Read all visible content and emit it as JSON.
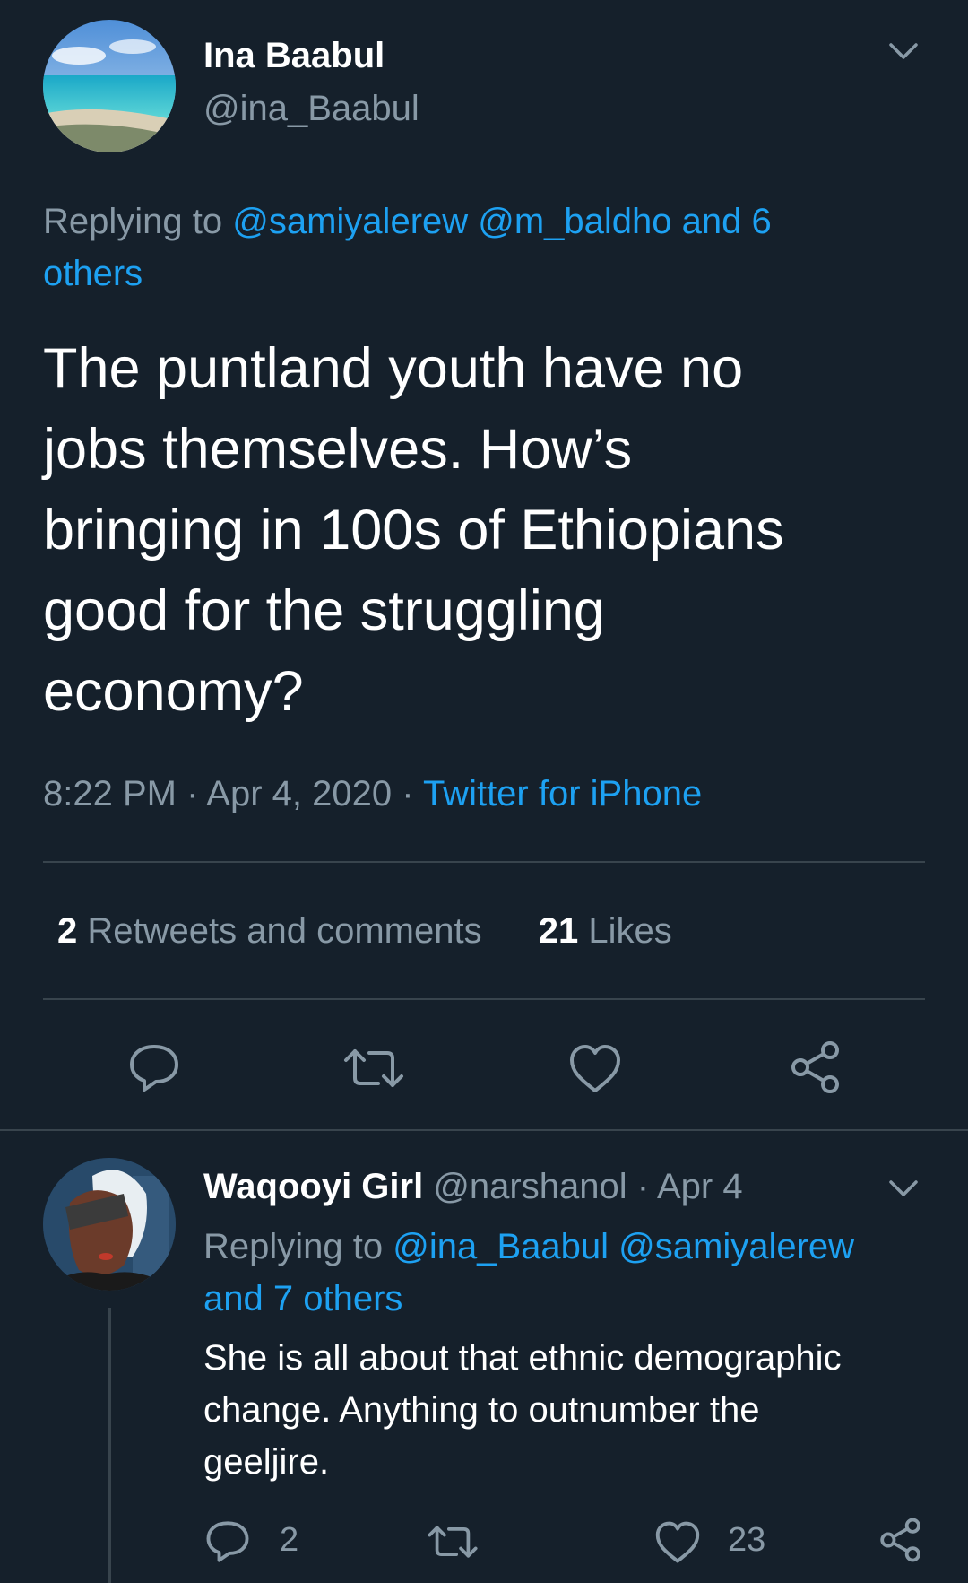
{
  "tweet": {
    "author_name": "Ina Baabul",
    "author_handle": "@ina_Baabul",
    "replying_prefix": "Replying to",
    "replying_mentions_line1": "@samiyalerew @m_baldho and 6",
    "replying_mentions_line2": "others",
    "text_lines": [
      "The puntland youth have no",
      "jobs themselves. How’s",
      "bringing in 100s of Ethiopians",
      "good for the struggling",
      "economy?"
    ],
    "time": "8:22 PM · Apr 4, 2020 ·",
    "source": "Twitter for iPhone",
    "retweets_count": "2",
    "retweets_label": "Retweets and comments",
    "likes_count": "21",
    "likes_label": "Likes"
  },
  "reply": {
    "author_name": "Waqooyi Girl",
    "author_handle_date": "@narshanol · Apr 4",
    "replying_prefix": "Replying to",
    "replying_mentions_line1": "@ina_Baabul @samiyalerew",
    "replying_mentions_line2": "and 7 others",
    "text_lines": [
      "She is all about that ethnic demographic",
      "change. Anything to outnumber the",
      "geeljire."
    ],
    "reply_count": "2",
    "like_count": "23"
  },
  "colors": {
    "background": "#15202b",
    "link": "#1da1f2",
    "muted": "#8899a6",
    "divider": "#38444d"
  },
  "icons": [
    "chevron-down-icon",
    "reply-icon",
    "retweet-icon",
    "like-icon",
    "share-icon"
  ]
}
